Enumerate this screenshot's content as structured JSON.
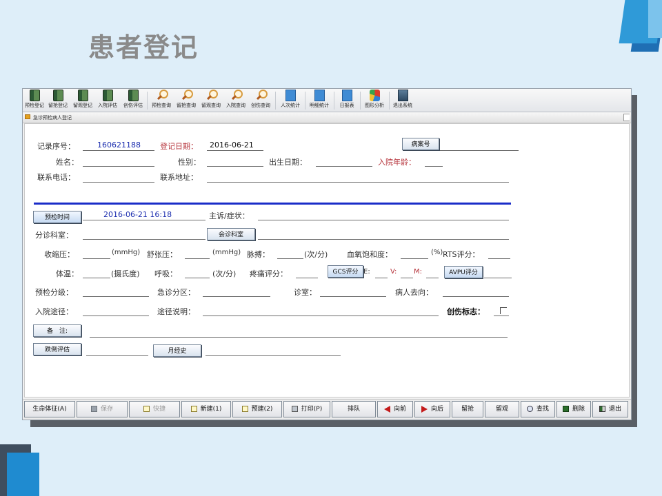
{
  "slide": {
    "title": "患者登记"
  },
  "toolbar": {
    "items": [
      {
        "label": "预检登记",
        "icon": "register-book-icon"
      },
      {
        "label": "留抢登记",
        "icon": "register-book-icon"
      },
      {
        "label": "留观登记",
        "icon": "register-book-icon"
      },
      {
        "label": "入院评估",
        "icon": "register-book-icon"
      },
      {
        "label": "创伤评估",
        "icon": "register-book-icon"
      },
      {
        "label": "预检查询",
        "icon": "magnifier-icon"
      },
      {
        "label": "留抢查询",
        "icon": "magnifier-icon"
      },
      {
        "label": "留观查询",
        "icon": "magnifier-icon"
      },
      {
        "label": "入院查询",
        "icon": "magnifier-icon"
      },
      {
        "label": "创伤查询",
        "icon": "magnifier-icon"
      },
      {
        "label": "人次统计",
        "icon": "stats-chart-icon"
      },
      {
        "label": "明细统计",
        "icon": "stats-chart-icon"
      },
      {
        "label": "日报表",
        "icon": "stats-chart-icon"
      },
      {
        "label": "图形分析",
        "icon": "pie-chart-icon"
      },
      {
        "label": "退出系统",
        "icon": "exit-door-icon"
      }
    ]
  },
  "subwindow": {
    "title": "急诊预检病人登记"
  },
  "form": {
    "record_no_label": "记录序号：",
    "record_no_value": "160621188",
    "reg_date_label": "登记日期：",
    "reg_date_value": "2016-06-21",
    "case_no_button": "病案号",
    "name_label": "姓名：",
    "gender_label": "性别：",
    "birth_label": "出生日期：",
    "admit_age_label": "入院年龄：",
    "phone_label": "联系电话：",
    "address_label": "联系地址：",
    "triage_time_button": "预检时间",
    "triage_time_value": "2016-06-21  16:18",
    "complaint_label": "主诉/症状：",
    "dept_label": "分诊科室：",
    "consult_button": "会诊科室",
    "systolic_label": "收缩压：",
    "mmhg1": "(mmHg)",
    "diastolic_label": "舒张压：",
    "mmhg2": "(mmHg)",
    "pulse_label": "脉搏：",
    "pulse_unit": "(次/分)",
    "spo2_label": "血氧饱和度：",
    "spo2_unit": "(%)",
    "rts_label": "RTS评分：",
    "temp_label": "体温：",
    "temp_unit": "(摄氏度)",
    "resp_label": "呼吸：",
    "resp_unit": "(次/分)",
    "pain_label": "疼痛评分：",
    "gcs_button": "GCS评分",
    "e_label": "E:",
    "v_label": "V:",
    "m_label": "M:",
    "avpu_button": "AVPU评分",
    "triage_level_label": "预检分级：",
    "er_zone_label": "急诊分区：",
    "room_label": "诊室：",
    "destination_label": "病人去向：",
    "admit_route_label": "入院途径：",
    "route_desc_label": "途径说明：",
    "trauma_flag_label": "创伤标志：",
    "remark_button": "备　注:",
    "fall_button": "跌倒评估",
    "menses_button": "月经史"
  },
  "bottom": {
    "vitals": "生命体征(A)",
    "save": "保存",
    "quick": "快捷",
    "new": "新建(1)",
    "pre": "预建(2)",
    "print": "打印(P)",
    "queue": "排队",
    "prev": "向前",
    "next": "向后",
    "rescue": "留抢",
    "observe": "留观",
    "find": "查找",
    "delete": "删除",
    "exit": "退出"
  }
}
